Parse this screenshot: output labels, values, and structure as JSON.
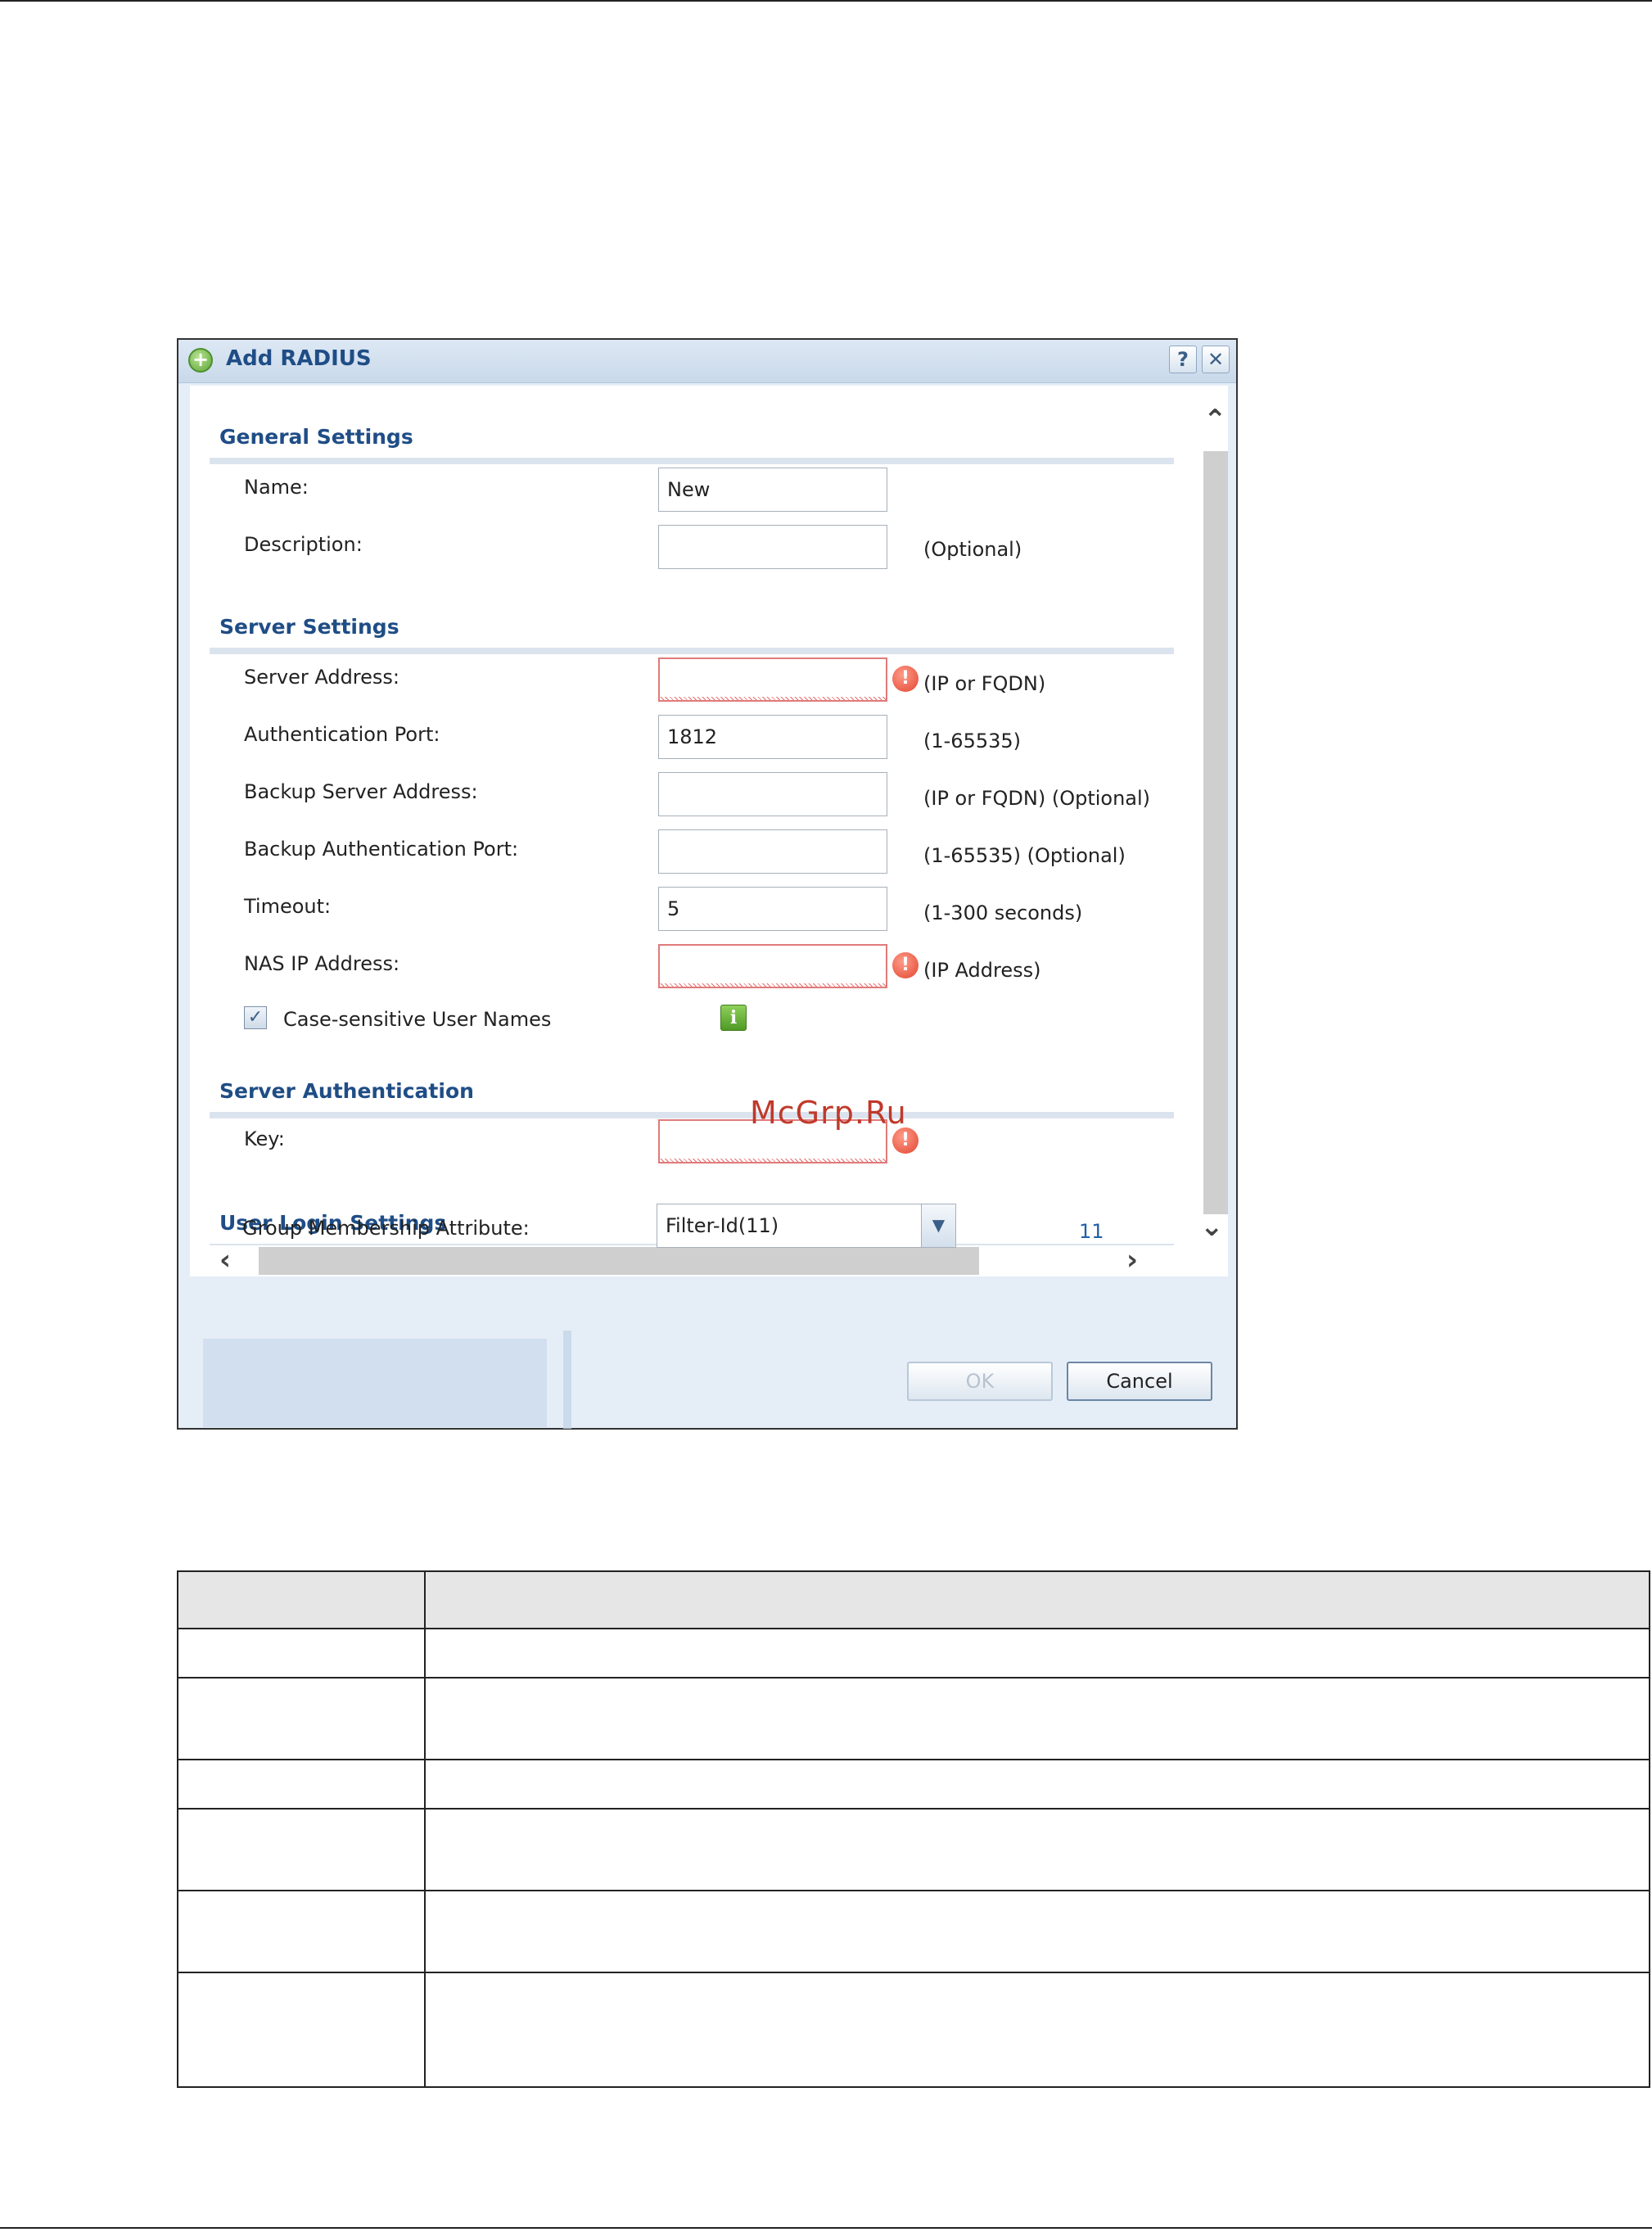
{
  "dialog": {
    "title": "Add RADIUS",
    "help_label": "?",
    "close_label": "✕"
  },
  "sections": {
    "general": "General Settings",
    "server": "Server Settings",
    "auth": "Server Authentication",
    "login": "User Login Settings"
  },
  "fields": {
    "name": {
      "label": "Name:",
      "value": "New"
    },
    "description": {
      "label": "Description:",
      "value": "",
      "hint": "(Optional)"
    },
    "server_address": {
      "label": "Server Address:",
      "value": "",
      "hint": "(IP or FQDN)"
    },
    "auth_port": {
      "label": "Authentication Port:",
      "value": "1812",
      "hint": "(1-65535)"
    },
    "backup_server": {
      "label": "Backup Server Address:",
      "value": "",
      "hint": "(IP or FQDN) (Optional)"
    },
    "backup_port": {
      "label": "Backup Authentication Port:",
      "value": "",
      "hint": "(1-65535) (Optional)"
    },
    "timeout": {
      "label": "Timeout:",
      "value": "5",
      "hint": "(1-300 seconds)"
    },
    "nas_ip": {
      "label": "NAS IP Address:",
      "value": "",
      "hint": "(IP Address)"
    },
    "case_sensitive": {
      "label": "Case-sensitive User Names",
      "checked": true
    },
    "key": {
      "label": "Key:",
      "value": ""
    },
    "group_attr": {
      "label": "Group Membership Attribute:",
      "selected": "Filter-Id(11)",
      "number": "11"
    }
  },
  "buttons": {
    "ok": "OK",
    "cancel": "Cancel"
  },
  "watermark": "McGrp.Ru",
  "colors": {
    "section_title": "#1f4d86",
    "error": "#e2452f",
    "info": "#4f9a25",
    "dialog_bg": "#e5eef7"
  }
}
